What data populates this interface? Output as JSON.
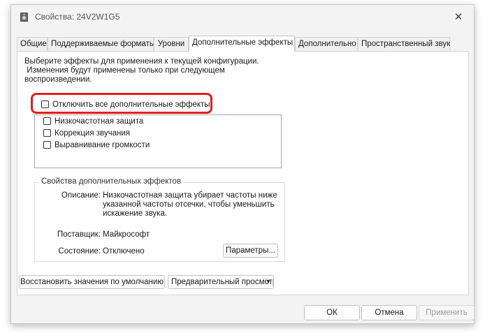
{
  "window": {
    "title": "Свойства: 24V2W1G5",
    "close_glyph": "✕"
  },
  "tabs": [
    {
      "label": "Общие"
    },
    {
      "label": "Поддерживаемые форматы"
    },
    {
      "label": "Уровни"
    },
    {
      "label": "Дополнительные эффекты",
      "active": true
    },
    {
      "label": "Дополнительно"
    },
    {
      "label": "Пространственный звук"
    }
  ],
  "description": {
    "line1": "Выберите эффекты для применения к текущей конфигурации.",
    "line2": " Изменения будут применены только при следующем",
    "line3": "воспроизведении."
  },
  "disable_all": {
    "label": "Отключить все дополнительные эффекты",
    "checked": false
  },
  "effects": [
    {
      "label": "Низкочастотная защита",
      "checked": false
    },
    {
      "label": "Коррекция звучания",
      "checked": false
    },
    {
      "label": "Выравнивание громкости",
      "checked": false
    }
  ],
  "properties": {
    "title": "Свойства дополнительных эффектов",
    "description_label": "Описание:",
    "description_lines": [
      "Низкочастотная защита убирает частоты ниже",
      "указанной частоты отсечки, чтобы уменьшить",
      "искажение звука."
    ],
    "provider_label": "Поставщик:",
    "provider_value": "Майкрософт",
    "status_label": "Состояние:",
    "status_value": "Отключено",
    "params_button": "Параметры..."
  },
  "buttons": {
    "restore_defaults": "Восстановить значения по умолчанию",
    "preview": "Предварительный просмотр",
    "ok": "ОК",
    "cancel": "Отмена",
    "apply": "Применить"
  },
  "colors": {
    "highlight": "#e41e1e"
  },
  "icons": {
    "app": "speaker-icon",
    "close": "close-icon",
    "dropdown": "chevron-down-icon"
  }
}
